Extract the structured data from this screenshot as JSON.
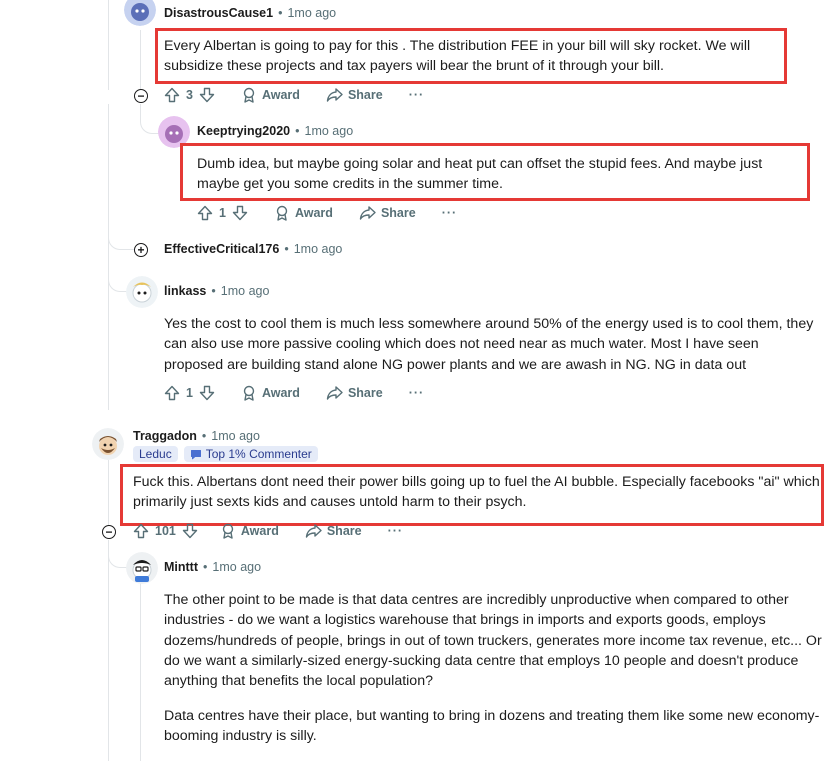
{
  "comments": [
    {
      "username": "DisastrousCause1",
      "time": "1mo ago",
      "text": "Every Albertan is going to pay for this . The distribution FEE in your bill will sky rocket. We will subsidize these projects and tax payers will bear the brunt of it through your bill.",
      "votes": "3",
      "award_label": "Award",
      "share_label": "Share",
      "more_label": "···"
    },
    {
      "username": "Keeptrying2020",
      "time": "1mo ago",
      "text": "Dumb idea, but maybe going solar and heat put can offset the stupid fees. And maybe just maybe get you some credits in the summer time.",
      "votes": "1",
      "award_label": "Award",
      "share_label": "Share",
      "more_label": "···"
    },
    {
      "username": "EffectiveCritical176",
      "time": "1mo ago"
    },
    {
      "username": "linkass",
      "time": "1mo ago",
      "text": "Yes the cost to cool them is much less somewhere around 50% of the energy used is to cool them, they can also use more passive cooling which does not need near as much water. Most I have seen proposed are building stand alone NG power plants and we are awash in NG. NG in data out",
      "votes": "1",
      "award_label": "Award",
      "share_label": "Share",
      "more_label": "···"
    },
    {
      "username": "Traggadon",
      "time": "1mo ago",
      "flairs": [
        "Leduc",
        "Top 1% Commenter"
      ],
      "text": "Fuck this. Albertans dont need their power bills going up to fuel the AI bubble. Especially facebooks \"ai\" which primarily just sexts kids and causes untold harm to their psych.",
      "votes": "101",
      "award_label": "Award",
      "share_label": "Share",
      "more_label": "···"
    },
    {
      "username": "Minttt",
      "time": "1mo ago",
      "text_p1": "The other point to be made is that data centres are incredibly unproductive when compared to other industries - do we want a logistics warehouse that brings in imports and exports goods, employs dozems/hundreds of people, brings in out of town truckers, generates more income tax revenue, etc... Or do we want a similarly-sized energy-sucking data centre that employs 10 people and doesn't produce anything that benefits the local population?",
      "text_p2": "Data centres have their place, but wanting to bring in dozens and treating them like some new economy-booming industry is silly."
    }
  ],
  "dot": "•",
  "colors": {
    "highlight": "#e53935",
    "meta": "#576f76",
    "flair_bg": "#e5ebf8"
  }
}
